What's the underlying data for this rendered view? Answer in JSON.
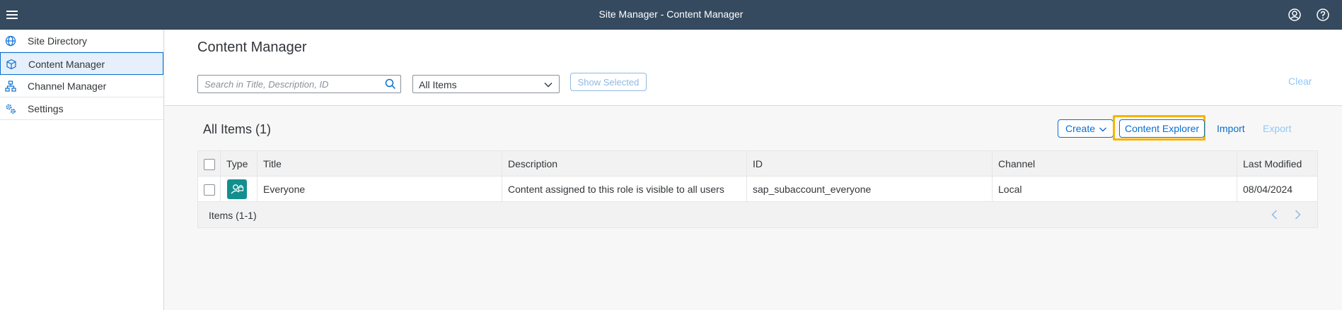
{
  "shell": {
    "title": "Site Manager - Content Manager",
    "icons": [
      "menu-icon",
      "user-icon",
      "help-icon"
    ]
  },
  "sidebar": {
    "items": [
      {
        "label": "Site Directory",
        "icon": "globe-icon",
        "active": false
      },
      {
        "label": "Content Manager",
        "icon": "cube-icon",
        "active": true
      },
      {
        "label": "Channel Manager",
        "icon": "hierarchy-icon",
        "active": false
      },
      {
        "label": "Settings",
        "icon": "settings-icon",
        "active": false
      }
    ]
  },
  "main": {
    "title": "Content Manager",
    "search": {
      "placeholder": "Search in Title, Description, ID",
      "value": ""
    },
    "filter": {
      "selected": "All Items"
    },
    "show_selected_label": "Show Selected",
    "clear_label": "Clear"
  },
  "table": {
    "title": "All Items (1)",
    "toolbar": {
      "create_label": "Create",
      "content_explorer_label": "Content Explorer",
      "import_label": "Import",
      "export_label": "Export"
    },
    "columns": [
      "Type",
      "Title",
      "Description",
      "ID",
      "Channel",
      "Last Modified"
    ],
    "rows": [
      {
        "type_icon": "role-user-lock-icon",
        "title": "Everyone",
        "description": "Content assigned to this role is visible to all users",
        "id": "sap_subaccount_everyone",
        "channel": "Local",
        "last_modified": "08/04/2024"
      }
    ],
    "footer": "Items (1-1)"
  },
  "colors": {
    "shell": "#354a5f",
    "accent": "#0a6ed1",
    "highlight": "#f5b400",
    "type_icon_bg": "#138e8f"
  }
}
